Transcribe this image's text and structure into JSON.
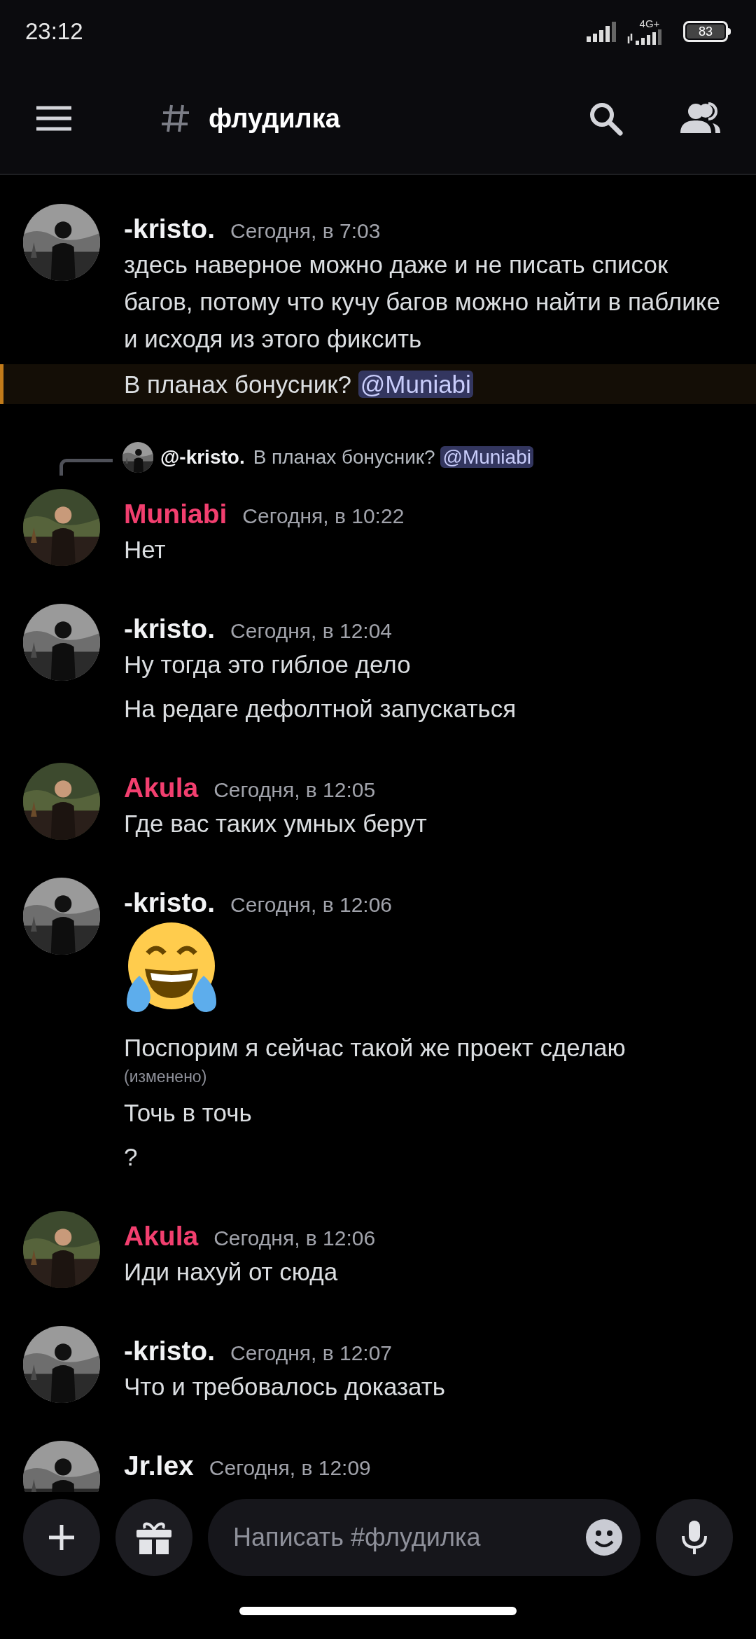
{
  "status_bar": {
    "time": "23:12",
    "network": "4G+",
    "battery": "83"
  },
  "header": {
    "channel": "флудилка"
  },
  "messages": [
    {
      "author": "-kristo.",
      "color": "#f2f3f5",
      "time": "Сегодня, в 7:03",
      "lines": [
        {
          "kind": "text",
          "text": "здесь наверное можно даже и не писать список багов, потому что кучу багов можно найти в паблике и исходя из этого фиксить",
          "highlighted": false
        },
        {
          "kind": "text",
          "text": "В планах бонусник?",
          "mention": "@Muniabi",
          "highlighted": true
        }
      ]
    },
    {
      "author": "Muniabi",
      "color": "#f23f6f",
      "time": "Сегодня, в 10:22",
      "reply": {
        "author": "@-kristo.",
        "text": "В планах бонусник?",
        "mention": "@Muniabi"
      },
      "lines": [
        {
          "kind": "text",
          "text": "Нет",
          "highlighted": false
        }
      ]
    },
    {
      "author": "-kristo.",
      "color": "#f2f3f5",
      "time": "Сегодня, в 12:04",
      "lines": [
        {
          "kind": "text",
          "text": "Ну тогда это гиблое дело",
          "highlighted": false
        },
        {
          "kind": "text",
          "text": "На редаге дефолтной запускаться",
          "highlighted": false
        }
      ]
    },
    {
      "author": "Akula",
      "color": "#f23f6f",
      "time": "Сегодня, в 12:05",
      "lines": [
        {
          "kind": "text",
          "text": "Где вас таких умных берут",
          "highlighted": false
        }
      ]
    },
    {
      "author": "-kristo.",
      "color": "#f2f3f5",
      "time": "Сегодня, в 12:06",
      "lines": [
        {
          "kind": "emoji"
        },
        {
          "kind": "text",
          "text": "Поспорим я сейчас такой же проект сделаю",
          "edited": "(изменено)",
          "highlighted": false
        },
        {
          "kind": "text",
          "text": "Точь в точь",
          "highlighted": false
        },
        {
          "kind": "text",
          "text": "?",
          "highlighted": false
        }
      ]
    },
    {
      "author": "Akula",
      "color": "#f23f6f",
      "time": "Сегодня, в 12:06",
      "lines": [
        {
          "kind": "text",
          "text": "Иди нахуй от сюда",
          "highlighted": false
        }
      ]
    },
    {
      "author": "-kristo.",
      "color": "#f2f3f5",
      "time": "Сегодня, в 12:07",
      "lines": [
        {
          "kind": "text",
          "text": "Что и требовалось доказать",
          "highlighted": false
        }
      ]
    },
    {
      "author": "Jr.lex",
      "color": "#f2f3f5",
      "time": "Сегодня, в 12:09"
    }
  ],
  "composer": {
    "placeholder": "Написать #флудилка"
  }
}
